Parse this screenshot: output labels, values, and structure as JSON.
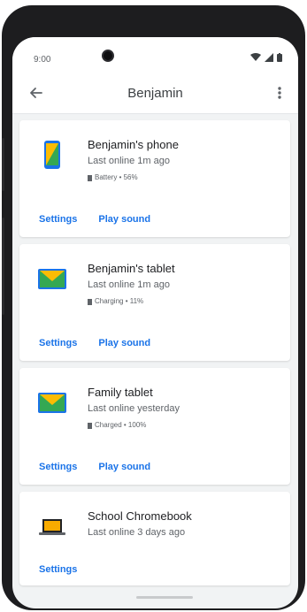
{
  "status": {
    "time": "9:00"
  },
  "appbar": {
    "title": "Benjamin"
  },
  "devices": [
    {
      "name": "Benjamin's phone",
      "last_online": "Last online 1m ago",
      "meta": "Battery • 56%",
      "icon": "phone-icon",
      "actions": [
        "Settings",
        "Play sound"
      ]
    },
    {
      "name": "Benjamin's tablet",
      "last_online": "Last online 1m ago",
      "meta": "Charging • 11%",
      "icon": "tablet-icon",
      "actions": [
        "Settings",
        "Play sound"
      ]
    },
    {
      "name": "Family tablet",
      "last_online": "Last online yesterday",
      "meta": "Charged • 100%",
      "icon": "tablet-icon",
      "actions": [
        "Settings",
        "Play sound"
      ]
    },
    {
      "name": "School Chromebook",
      "last_online": "Last online 3 days ago",
      "meta": "",
      "icon": "laptop-icon",
      "actions": [
        "Settings"
      ]
    }
  ],
  "colors": {
    "accent": "#1a73e8",
    "background": "#f1f3f4",
    "frame": "#1d1d1f"
  }
}
